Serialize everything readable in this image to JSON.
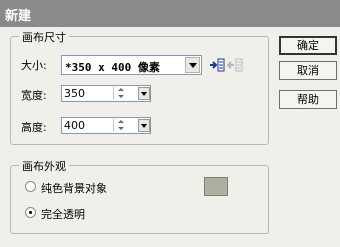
{
  "window": {
    "title": "新建"
  },
  "canvas_size": {
    "legend": "画布尺寸",
    "size_label": "大小:",
    "size_value": "*350 x 400 像素",
    "width_label": "宽度:",
    "width_value": "350",
    "height_label": "高度:",
    "height_value": "400"
  },
  "canvas_appearance": {
    "legend": "画布外观",
    "options": [
      {
        "label": "纯色背景对象",
        "selected": false
      },
      {
        "label": "完全透明",
        "selected": true
      }
    ],
    "swatch_color": "#aeaea1"
  },
  "buttons": {
    "ok": "确定",
    "cancel": "取消",
    "help": "帮助"
  }
}
